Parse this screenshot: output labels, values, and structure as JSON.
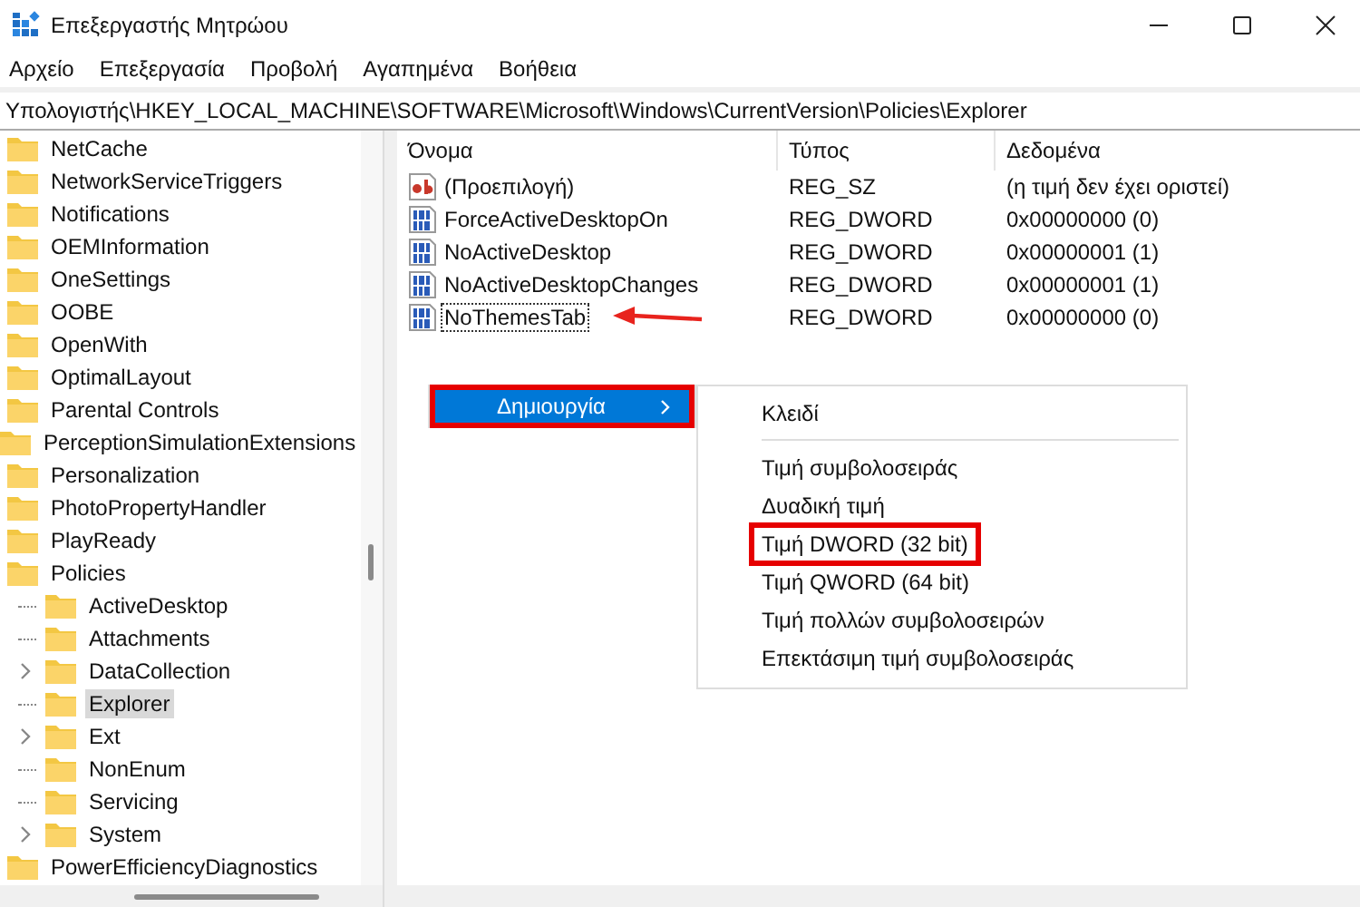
{
  "window": {
    "title": "Επεξεργαστής Μητρώου"
  },
  "menu": [
    "Αρχείο",
    "Επεξεργασία",
    "Προβολή",
    "Αγαπημένα",
    "Βοήθεια"
  ],
  "address": "Υπολογιστής\\HKEY_LOCAL_MACHINE\\SOFTWARE\\Microsoft\\Windows\\CurrentVersion\\Policies\\Explorer",
  "tree": [
    {
      "label": "NetCache",
      "selected": false
    },
    {
      "label": "NetworkServiceTriggers",
      "selected": false
    },
    {
      "label": "Notifications",
      "selected": false
    },
    {
      "label": "OEMInformation",
      "selected": false
    },
    {
      "label": "OneSettings",
      "selected": false
    },
    {
      "label": "OOBE",
      "selected": false
    },
    {
      "label": "OpenWith",
      "selected": false
    },
    {
      "label": "OptimalLayout",
      "selected": false
    },
    {
      "label": "Parental Controls",
      "selected": false
    },
    {
      "label": "PerceptionSimulationExtensions",
      "selected": false
    },
    {
      "label": "Personalization",
      "selected": false
    },
    {
      "label": "PhotoPropertyHandler",
      "selected": false
    },
    {
      "label": "PlayReady",
      "selected": false
    },
    {
      "label": "Policies",
      "selected": false,
      "children": [
        {
          "label": "ActiveDesktop",
          "selected": false,
          "expandable": false
        },
        {
          "label": "Attachments",
          "selected": false,
          "expandable": false
        },
        {
          "label": "DataCollection",
          "selected": false,
          "expandable": true
        },
        {
          "label": "Explorer",
          "selected": true,
          "expandable": false
        },
        {
          "label": "Ext",
          "selected": false,
          "expandable": true
        },
        {
          "label": "NonEnum",
          "selected": false,
          "expandable": false
        },
        {
          "label": "Servicing",
          "selected": false,
          "expandable": false
        },
        {
          "label": "System",
          "selected": false,
          "expandable": true
        }
      ]
    },
    {
      "label": "PowerEfficiencyDiagnostics",
      "selected": false
    }
  ],
  "table": {
    "columns": [
      "Όνομα",
      "Τύπος",
      "Δεδομένα"
    ],
    "rows": [
      {
        "kind": "string",
        "name": "(Προεπιλογή)",
        "type": "REG_SZ",
        "data": "(η τιμή δεν έχει οριστεί)",
        "focused": false,
        "annotated": false
      },
      {
        "kind": "dword",
        "name": "ForceActiveDesktopOn",
        "type": "REG_DWORD",
        "data": "0x00000000 (0)",
        "focused": false,
        "annotated": false
      },
      {
        "kind": "dword",
        "name": "NoActiveDesktop",
        "type": "REG_DWORD",
        "data": "0x00000001 (1)",
        "focused": false,
        "annotated": false
      },
      {
        "kind": "dword",
        "name": "NoActiveDesktopChanges",
        "type": "REG_DWORD",
        "data": "0x00000001 (1)",
        "focused": false,
        "annotated": false
      },
      {
        "kind": "dword",
        "name": "NoThemesTab",
        "type": "REG_DWORD",
        "data": "0x00000000 (0)",
        "focused": true,
        "annotated": true
      }
    ]
  },
  "context_menu": {
    "items": [
      {
        "label": "Δημιουργία",
        "selected": true,
        "highlighted": true
      }
    ]
  },
  "submenu": {
    "items": [
      {
        "label": "Κλειδί",
        "highlighted": false,
        "separator_after": true
      },
      {
        "label": "Τιμή συμβολοσειράς",
        "highlighted": false,
        "separator_after": false
      },
      {
        "label": "Δυαδική τιμή",
        "highlighted": false,
        "separator_after": false
      },
      {
        "label": "Τιμή DWORD (32 bit)",
        "highlighted": true,
        "separator_after": false
      },
      {
        "label": "Τιμή QWORD (64 bit)",
        "highlighted": false,
        "separator_after": false
      },
      {
        "label": "Τιμή πολλών συμβολοσειρών",
        "highlighted": false,
        "separator_after": false
      },
      {
        "label": "Επεκτάσιμη τιμή συμβολοσειράς",
        "highlighted": false,
        "separator_after": false
      }
    ]
  }
}
